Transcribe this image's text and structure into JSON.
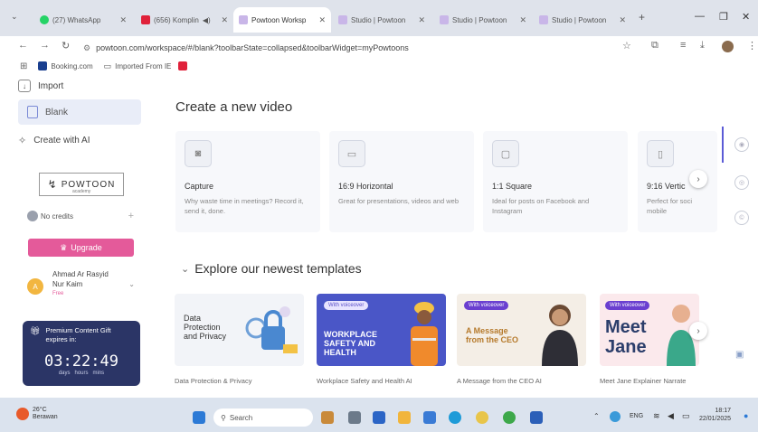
{
  "browser": {
    "tabs": [
      {
        "label": "(27) WhatsApp",
        "color": "#25d366"
      },
      {
        "label": "(656) Komplin",
        "color": "#e0213a"
      },
      {
        "label": "Powtoon Worksp",
        "color": "#c9b6e8"
      },
      {
        "label": "Studio | Powtoon",
        "color": "#c9b6e8"
      },
      {
        "label": "Studio | Powtoon",
        "color": "#c9b6e8"
      },
      {
        "label": "Studio | Powtoon",
        "color": "#c9b6e8"
      }
    ],
    "new_tab": "+",
    "url": "powtoon.com/workspace/#/blank?toolbarState=collapsed&toolbarWidget=myPowtoons",
    "bookmarks": [
      {
        "label": "Booking.com",
        "icon": "booking-icon"
      },
      {
        "label": "Imported From IE",
        "icon": "folder-icon"
      }
    ]
  },
  "sidebar": {
    "import_label": "Import",
    "blank_label": "Blank",
    "create_ai_label": "Create with AI",
    "logo_text": "POWTOON",
    "logo_sub": "academy",
    "credits_label": "No credits",
    "upgrade_label": "Upgrade",
    "user_name": "Ahmad Ar Rasyid",
    "user_name2": "Nur Kaim",
    "user_plan": "Free",
    "avatar_initial": "A",
    "promo": {
      "title": "Premium Content Gift",
      "subtitle": "expires in:",
      "time": "03:22:49",
      "units": "days   hours   mins"
    }
  },
  "main": {
    "create_title": "Create a new video",
    "cards": [
      {
        "title": "Capture",
        "desc": "Why waste time in meetings? Record it, send it, done.",
        "icon": "capture-icon"
      },
      {
        "title": "16:9 Horizontal",
        "desc": "Great for presentations, videos and web",
        "icon": "horizontal-icon"
      },
      {
        "title": "1:1 Square",
        "desc": "Ideal for posts on Facebook and Instagram",
        "icon": "square-icon"
      },
      {
        "title": "9:16 Vertic",
        "desc": "Perfect for soci mobile",
        "icon": "vertical-icon"
      }
    ],
    "templates_title": "Explore our newest templates",
    "templates": [
      {
        "caption": "Data Protection & Privacy",
        "thumb_text": "Data Protection and Privacy"
      },
      {
        "caption": "Workplace Safety and Health AI",
        "thumb_text": "WORKPLACE SAFETY AND HEALTH",
        "badge": "With voiceover"
      },
      {
        "caption": "A Message from the CEO AI",
        "thumb_text": "A Message from the CEO",
        "badge": "With voiceover"
      },
      {
        "caption": "Meet Jane Explainer Narrate",
        "thumb_text": "Meet Jane",
        "badge": "With voiceover"
      }
    ]
  },
  "taskbar": {
    "weather_temp": "26°C",
    "weather_desc": "Berawan",
    "search_placeholder": "Search",
    "lang": "ENG",
    "time": "18:17",
    "date": "22/01/2025"
  },
  "colors": {
    "accent_pink": "#e45a9a",
    "promo_bg": "#2b3566",
    "workplace_bg": "#4a56c7",
    "message_bg": "#f4eee6",
    "jane_bg": "#fbe9ec"
  }
}
